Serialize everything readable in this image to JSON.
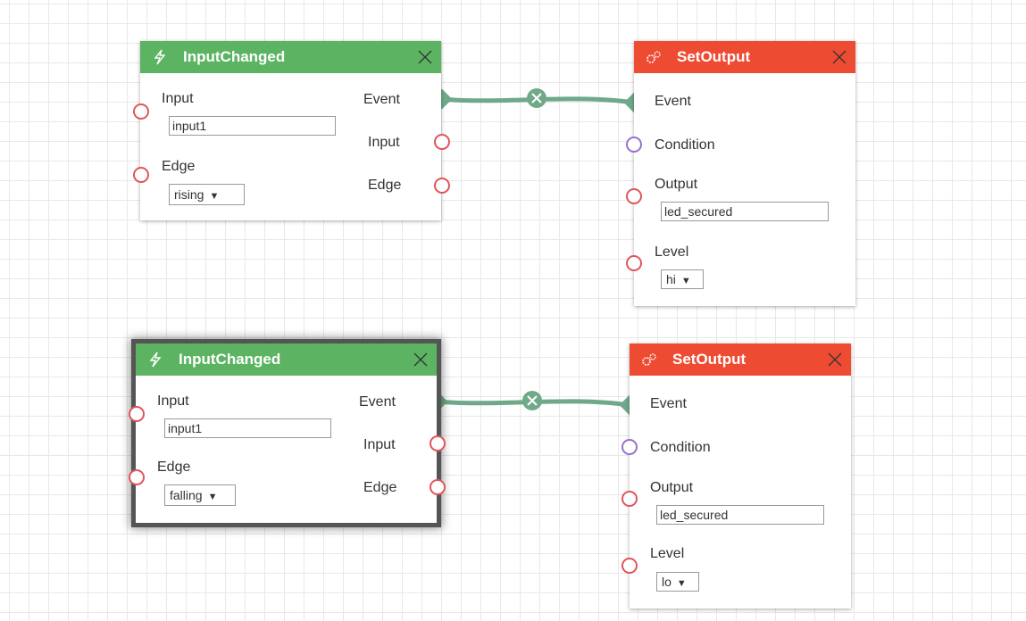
{
  "colors": {
    "green_header": "#5cb462",
    "red_header": "#ee4b33",
    "link": "#6fa98a",
    "port_red": "#e0555b",
    "port_purple": "#9a6fd0"
  },
  "icons": {
    "trigger": "lightning-icon",
    "action": "gears-icon",
    "close": "close-icon"
  },
  "nodes": {
    "trigger1": {
      "title": "InputChanged",
      "input_label": "Input",
      "input_value": "input1",
      "edge_label": "Edge",
      "edge_value": "rising",
      "out_event": "Event",
      "out_input": "Input",
      "out_edge": "Edge"
    },
    "action1": {
      "title": "SetOutput",
      "event_label": "Event",
      "condition_label": "Condition",
      "output_label": "Output",
      "output_value": "led_secured",
      "level_label": "Level",
      "level_value": "hi"
    },
    "trigger2": {
      "title": "InputChanged",
      "input_label": "Input",
      "input_value": "input1",
      "edge_label": "Edge",
      "edge_value": "falling",
      "out_event": "Event",
      "out_input": "Input",
      "out_edge": "Edge"
    },
    "action2": {
      "title": "SetOutput",
      "event_label": "Event",
      "condition_label": "Condition",
      "output_label": "Output",
      "output_value": "led_secured",
      "level_label": "Level",
      "level_value": "lo"
    }
  }
}
